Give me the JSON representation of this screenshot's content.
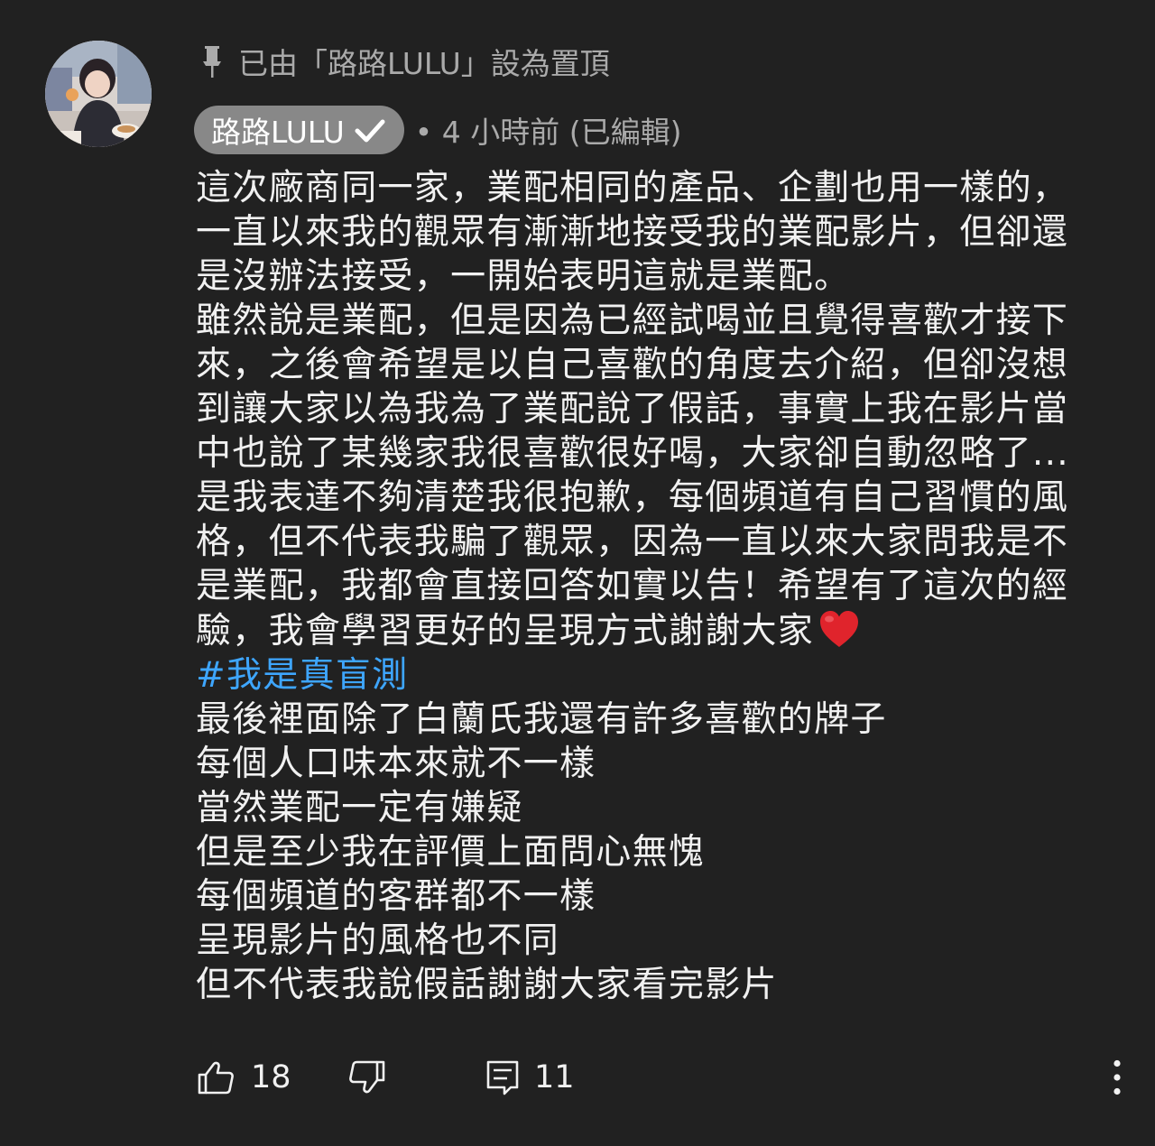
{
  "pinned": {
    "icon": "pin-icon",
    "text": "已由「路路LULU」設為置頂"
  },
  "author": {
    "name": "路路LULU",
    "verified_icon": "checkmark-icon",
    "avatar": "channel-avatar"
  },
  "timestamp": "• 4 小時前 (已編輯)",
  "body": {
    "lines": [
      "這次廠商同一家，業配相同的產品、企劃也用一樣的，",
      "一直以來我的觀眾有漸漸地接受我的業配影片，但卻還",
      "是沒辦法接受，一開始表明這就是業配。",
      "雖然說是業配，但是因為已經試喝並且覺得喜歡才接下",
      "來，之後會希望是以自己喜歡的角度去介紹，但卻沒想",
      "到讓大家以為我為了業配說了假話，事實上我在影片當",
      "中也說了某幾家我很喜歡很好喝，大家卻自動忽略了...",
      "是我表達不夠清楚我很抱歉，每個頻道有自己習慣的風",
      "格，但不代表我騙了觀眾，因為一直以來大家問我是不",
      "是業配，我都會直接回答如實以告！希望有了這次的經",
      "驗，我會學習更好的呈現方式謝謝大家"
    ],
    "heart_icon": "red-heart-emoji",
    "hashtag": "#我是真盲測",
    "lines_after": [
      "最後裡面除了白蘭氏我還有許多喜歡的牌子",
      "每個人口味本來就不一樣",
      "當然業配一定有嫌疑",
      "但是至少我在評價上面問心無愧",
      "每個頻道的客群都不一樣",
      "呈現影片的風格也不同",
      "但不代表我說假話謝謝大家看完影片"
    ]
  },
  "actions": {
    "like_icon": "thumbs-up-icon",
    "like_count": "18",
    "dislike_icon": "thumbs-down-icon",
    "reply_icon": "reply-icon",
    "reply_count": "11",
    "more_icon": "more-vertical-icon"
  },
  "colors": {
    "background": "#212121",
    "text": "#f1f1f1",
    "secondary_text": "#aaaaaa",
    "author_chip": "#888888",
    "hashtag": "#3ea6ff",
    "heart": "#e0242c"
  }
}
